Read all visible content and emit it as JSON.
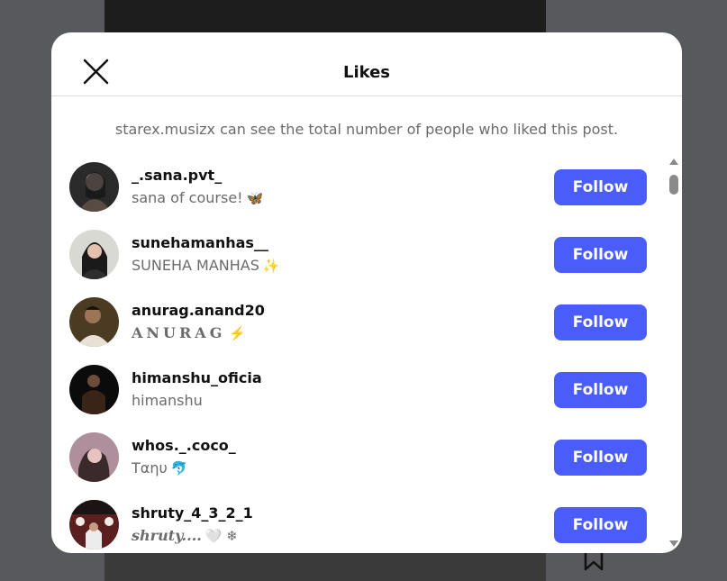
{
  "modal": {
    "title": "Likes",
    "notice": "starex.musizx can see the total number of people who liked this post."
  },
  "colors": {
    "accent": "#4a5dfb",
    "overlay": "#58595c"
  },
  "likes": [
    {
      "username": "_.sana.pvt_",
      "fullname": "sana of course!",
      "emoji": "🦋",
      "follow_label": "Follow"
    },
    {
      "username": "sunehamanhas__",
      "fullname": "SUNEHA MANHAS",
      "emoji": "✨",
      "follow_label": "Follow"
    },
    {
      "username": "anurag.anand20",
      "fullname": "ANURAG",
      "emoji": "⚡",
      "follow_label": "Follow"
    },
    {
      "username": "himanshu_oficia",
      "fullname": "himanshu",
      "emoji": "",
      "follow_label": "Follow"
    },
    {
      "username": "whos._.coco_",
      "fullname": "Tαηυ",
      "emoji": "🐬",
      "follow_label": "Follow"
    },
    {
      "username": "shruty_4_3_2_1",
      "fullname": "shruty....",
      "emoji": "🤍 ❄",
      "follow_label": "Follow"
    }
  ]
}
